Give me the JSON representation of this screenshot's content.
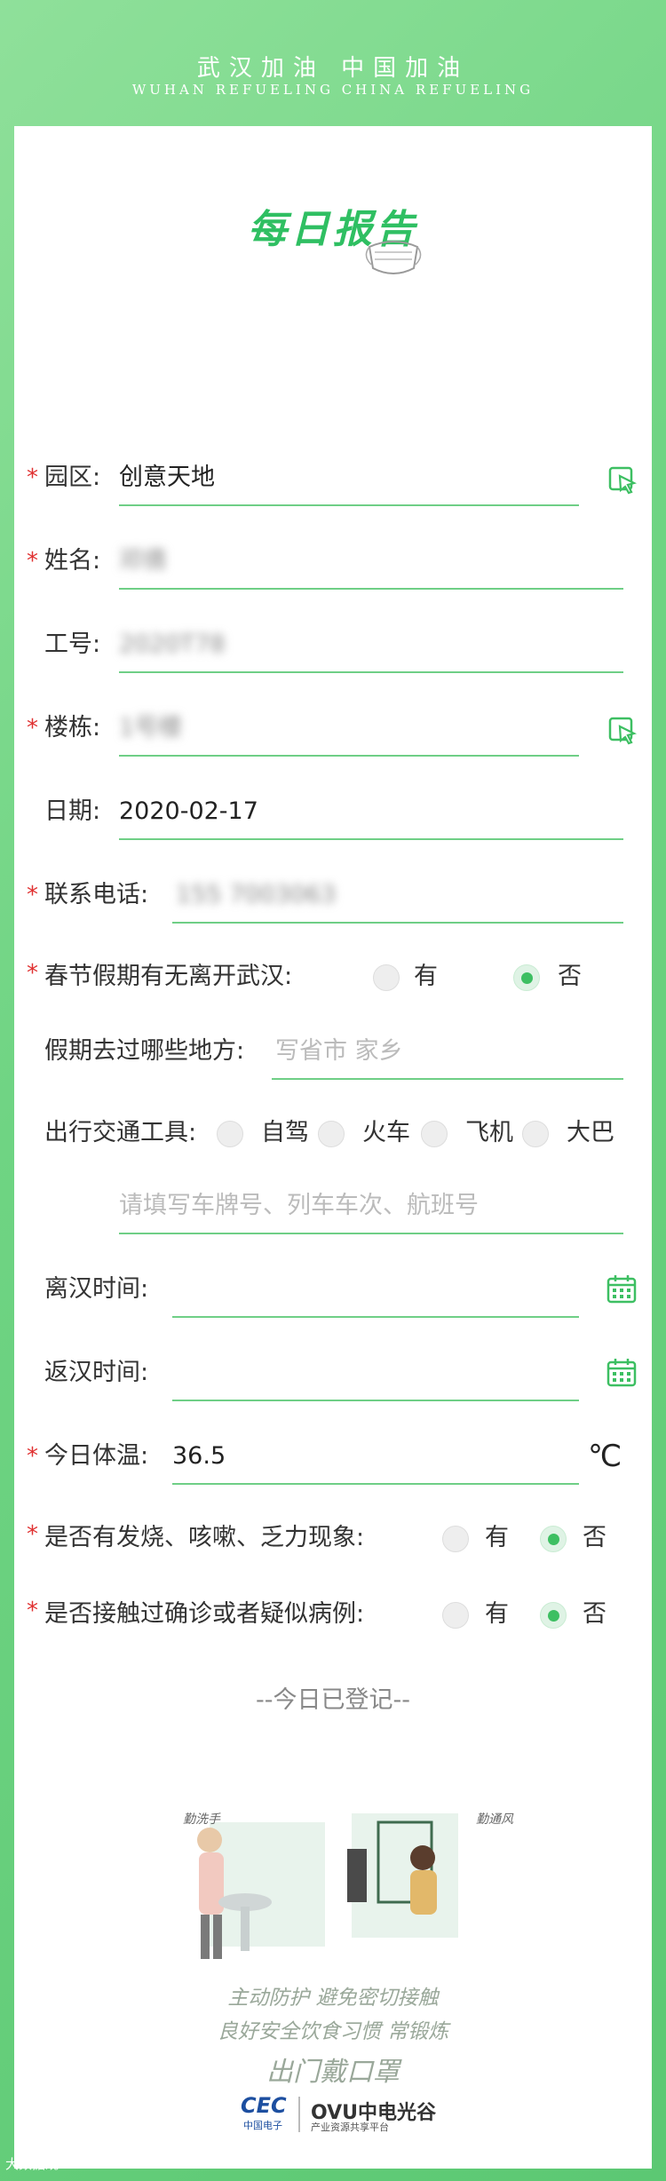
{
  "banner": {
    "title_cn": "武汉加油  中国加油",
    "title_en": "WUHAN REFUELING CHINA REFUELING"
  },
  "page_title": "每日报告",
  "form": {
    "park": {
      "label": "园区:",
      "value": "创意天地",
      "required": "*"
    },
    "name": {
      "label": "姓名:",
      "value": "邓倩",
      "required": "*"
    },
    "employee_id": {
      "label": "工号:",
      "value": "2020T78"
    },
    "building": {
      "label": "楼栋:",
      "value": "1号楼",
      "required": "*"
    },
    "date": {
      "label": "日期:",
      "value": "2020-02-17"
    },
    "phone": {
      "label": "联系电话:",
      "value": "155 7003063",
      "required": "*"
    },
    "left_wuhan": {
      "label": "春节假期有无离开武汉:",
      "required": "*",
      "options": [
        "有",
        "否"
      ],
      "selected": "否"
    },
    "places": {
      "label": "假期去过哪些地方:",
      "placeholder": "写省市 家乡"
    },
    "transport": {
      "label": "出行交通工具:",
      "options": [
        "自驾",
        "火车",
        "飞机",
        "大巴"
      ],
      "detail_placeholder": "请填写车牌号、列车车次、航班号"
    },
    "leave_time": {
      "label": "离汉时间:"
    },
    "return_time": {
      "label": "返汉时间:"
    },
    "temperature": {
      "label": "今日体温:",
      "value": "36.5",
      "unit": "℃",
      "required": "*"
    },
    "symptoms": {
      "label": "是否有发烧、咳嗽、乏力现象:",
      "required": "*",
      "options": [
        "有",
        "否"
      ],
      "selected": "否"
    },
    "contact": {
      "label": "是否接触过确诊或者疑似病例:",
      "required": "*",
      "options": [
        "有",
        "否"
      ],
      "selected": "否"
    }
  },
  "status_text": "--今日已登记--",
  "illustration": {
    "tag_left": "勤洗手",
    "tag_right": "勤通风",
    "slogan_1": "主动防护  避免密切接触",
    "slogan_2": "良好安全饮食习惯  常锻炼",
    "slogan_3": "出门戴口罩"
  },
  "footer": {
    "cec": "CEC",
    "cec_sub": "中国电子",
    "ovu": "OVU中电光谷",
    "ovu_sub": "产业资源共享平台"
  },
  "watermark": "大数据观",
  "colors": {
    "accent": "#3dbf62",
    "required": "#e03131",
    "line": "#6fcf86"
  }
}
